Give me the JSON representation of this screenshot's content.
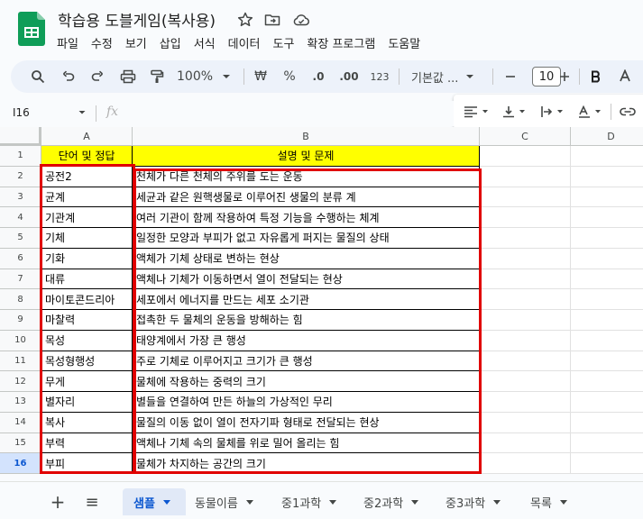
{
  "app": {
    "doc_title": "학습용 도블게임(복사용)",
    "menu": [
      "파일",
      "수정",
      "보기",
      "삽입",
      "서식",
      "데이터",
      "도구",
      "확장 프로그램",
      "도움말"
    ]
  },
  "toolbar": {
    "zoom": "100%",
    "currency": "₩",
    "percent": "%",
    "dec_decrease": ".0",
    "dec_increase": ".00",
    "number_format": "123",
    "font_name": "기본값 ...",
    "font_size": "10"
  },
  "formula_bar": {
    "name_box": "I16",
    "fx": "fx"
  },
  "grid": {
    "columns": [
      "A",
      "B",
      "C",
      "D"
    ],
    "rows": [
      "1",
      "2",
      "3",
      "4",
      "5",
      "6",
      "7",
      "8",
      "9",
      "10",
      "11",
      "12",
      "13",
      "14",
      "15",
      "16"
    ],
    "active_row": "16",
    "header": [
      "단어 및 정답",
      "설명 및 문제"
    ],
    "data": [
      [
        "공전2",
        "천체가 다른 천체의 주위를 도는 운동"
      ],
      [
        "균계",
        "세균과 같은 원핵생물로 이루어진 생물의 분류 계"
      ],
      [
        "기관계",
        "여러 기관이 함께 작용하여 특정 기능을 수행하는 체계"
      ],
      [
        "기체",
        "일정한 모양과 부피가 없고 자유롭게 퍼지는 물질의 상태"
      ],
      [
        "기화",
        "액체가 기체 상태로 변하는 현상"
      ],
      [
        "대류",
        "액체나 기체가 이동하면서 열이 전달되는 현상"
      ],
      [
        "마이토콘드리아",
        "세포에서 에너지를 만드는 세포 소기관"
      ],
      [
        "마찰력",
        "접촉한 두 물체의 운동을 방해하는 힘"
      ],
      [
        "목성",
        "태양계에서 가장 큰 행성"
      ],
      [
        "목성형행성",
        "주로 기체로 이루어지고 크기가 큰 행성"
      ],
      [
        "무게",
        "물체에 작용하는 중력의 크기"
      ],
      [
        "별자리",
        "별들을 연결하여 만든 하늘의 가상적인 무리"
      ],
      [
        "복사",
        "물질의 이동 없이 열이 전자기파 형태로 전달되는 현상"
      ],
      [
        "부력",
        "액체나 기체 속의 물체를 위로 밀어 올리는 힘"
      ],
      [
        "부피",
        "물체가 차지하는 공간의 크기"
      ]
    ]
  },
  "sheets": {
    "add": "+",
    "all_sheets": "≡",
    "tabs": [
      "샘플",
      "동물이름",
      "중1과학",
      "중2과학",
      "중3과학",
      "목록"
    ],
    "active": "샘플"
  },
  "colors": {
    "header_fill": "#ffff00",
    "highlight_box": "#e00000",
    "active_tab": "#0b57d0",
    "sheets_green": "#0f9d58"
  }
}
